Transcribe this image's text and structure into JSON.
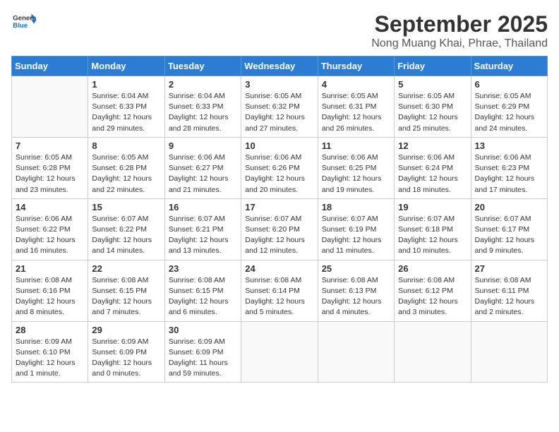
{
  "header": {
    "logo_general": "General",
    "logo_blue": "Blue",
    "month": "September 2025",
    "location": "Nong Muang Khai, Phrae, Thailand"
  },
  "days_of_week": [
    "Sunday",
    "Monday",
    "Tuesday",
    "Wednesday",
    "Thursday",
    "Friday",
    "Saturday"
  ],
  "weeks": [
    [
      {
        "day": "",
        "info": ""
      },
      {
        "day": "1",
        "info": "Sunrise: 6:04 AM\nSunset: 6:33 PM\nDaylight: 12 hours\nand 29 minutes."
      },
      {
        "day": "2",
        "info": "Sunrise: 6:04 AM\nSunset: 6:33 PM\nDaylight: 12 hours\nand 28 minutes."
      },
      {
        "day": "3",
        "info": "Sunrise: 6:05 AM\nSunset: 6:32 PM\nDaylight: 12 hours\nand 27 minutes."
      },
      {
        "day": "4",
        "info": "Sunrise: 6:05 AM\nSunset: 6:31 PM\nDaylight: 12 hours\nand 26 minutes."
      },
      {
        "day": "5",
        "info": "Sunrise: 6:05 AM\nSunset: 6:30 PM\nDaylight: 12 hours\nand 25 minutes."
      },
      {
        "day": "6",
        "info": "Sunrise: 6:05 AM\nSunset: 6:29 PM\nDaylight: 12 hours\nand 24 minutes."
      }
    ],
    [
      {
        "day": "7",
        "info": "Sunrise: 6:05 AM\nSunset: 6:28 PM\nDaylight: 12 hours\nand 23 minutes."
      },
      {
        "day": "8",
        "info": "Sunrise: 6:05 AM\nSunset: 6:28 PM\nDaylight: 12 hours\nand 22 minutes."
      },
      {
        "day": "9",
        "info": "Sunrise: 6:06 AM\nSunset: 6:27 PM\nDaylight: 12 hours\nand 21 minutes."
      },
      {
        "day": "10",
        "info": "Sunrise: 6:06 AM\nSunset: 6:26 PM\nDaylight: 12 hours\nand 20 minutes."
      },
      {
        "day": "11",
        "info": "Sunrise: 6:06 AM\nSunset: 6:25 PM\nDaylight: 12 hours\nand 19 minutes."
      },
      {
        "day": "12",
        "info": "Sunrise: 6:06 AM\nSunset: 6:24 PM\nDaylight: 12 hours\nand 18 minutes."
      },
      {
        "day": "13",
        "info": "Sunrise: 6:06 AM\nSunset: 6:23 PM\nDaylight: 12 hours\nand 17 minutes."
      }
    ],
    [
      {
        "day": "14",
        "info": "Sunrise: 6:06 AM\nSunset: 6:22 PM\nDaylight: 12 hours\nand 16 minutes."
      },
      {
        "day": "15",
        "info": "Sunrise: 6:07 AM\nSunset: 6:22 PM\nDaylight: 12 hours\nand 14 minutes."
      },
      {
        "day": "16",
        "info": "Sunrise: 6:07 AM\nSunset: 6:21 PM\nDaylight: 12 hours\nand 13 minutes."
      },
      {
        "day": "17",
        "info": "Sunrise: 6:07 AM\nSunset: 6:20 PM\nDaylight: 12 hours\nand 12 minutes."
      },
      {
        "day": "18",
        "info": "Sunrise: 6:07 AM\nSunset: 6:19 PM\nDaylight: 12 hours\nand 11 minutes."
      },
      {
        "day": "19",
        "info": "Sunrise: 6:07 AM\nSunset: 6:18 PM\nDaylight: 12 hours\nand 10 minutes."
      },
      {
        "day": "20",
        "info": "Sunrise: 6:07 AM\nSunset: 6:17 PM\nDaylight: 12 hours\nand 9 minutes."
      }
    ],
    [
      {
        "day": "21",
        "info": "Sunrise: 6:08 AM\nSunset: 6:16 PM\nDaylight: 12 hours\nand 8 minutes."
      },
      {
        "day": "22",
        "info": "Sunrise: 6:08 AM\nSunset: 6:15 PM\nDaylight: 12 hours\nand 7 minutes."
      },
      {
        "day": "23",
        "info": "Sunrise: 6:08 AM\nSunset: 6:15 PM\nDaylight: 12 hours\nand 6 minutes."
      },
      {
        "day": "24",
        "info": "Sunrise: 6:08 AM\nSunset: 6:14 PM\nDaylight: 12 hours\nand 5 minutes."
      },
      {
        "day": "25",
        "info": "Sunrise: 6:08 AM\nSunset: 6:13 PM\nDaylight: 12 hours\nand 4 minutes."
      },
      {
        "day": "26",
        "info": "Sunrise: 6:08 AM\nSunset: 6:12 PM\nDaylight: 12 hours\nand 3 minutes."
      },
      {
        "day": "27",
        "info": "Sunrise: 6:08 AM\nSunset: 6:11 PM\nDaylight: 12 hours\nand 2 minutes."
      }
    ],
    [
      {
        "day": "28",
        "info": "Sunrise: 6:09 AM\nSunset: 6:10 PM\nDaylight: 12 hours\nand 1 minute."
      },
      {
        "day": "29",
        "info": "Sunrise: 6:09 AM\nSunset: 6:09 PM\nDaylight: 12 hours\nand 0 minutes."
      },
      {
        "day": "30",
        "info": "Sunrise: 6:09 AM\nSunset: 6:09 PM\nDaylight: 11 hours\nand 59 minutes."
      },
      {
        "day": "",
        "info": ""
      },
      {
        "day": "",
        "info": ""
      },
      {
        "day": "",
        "info": ""
      },
      {
        "day": "",
        "info": ""
      }
    ]
  ]
}
